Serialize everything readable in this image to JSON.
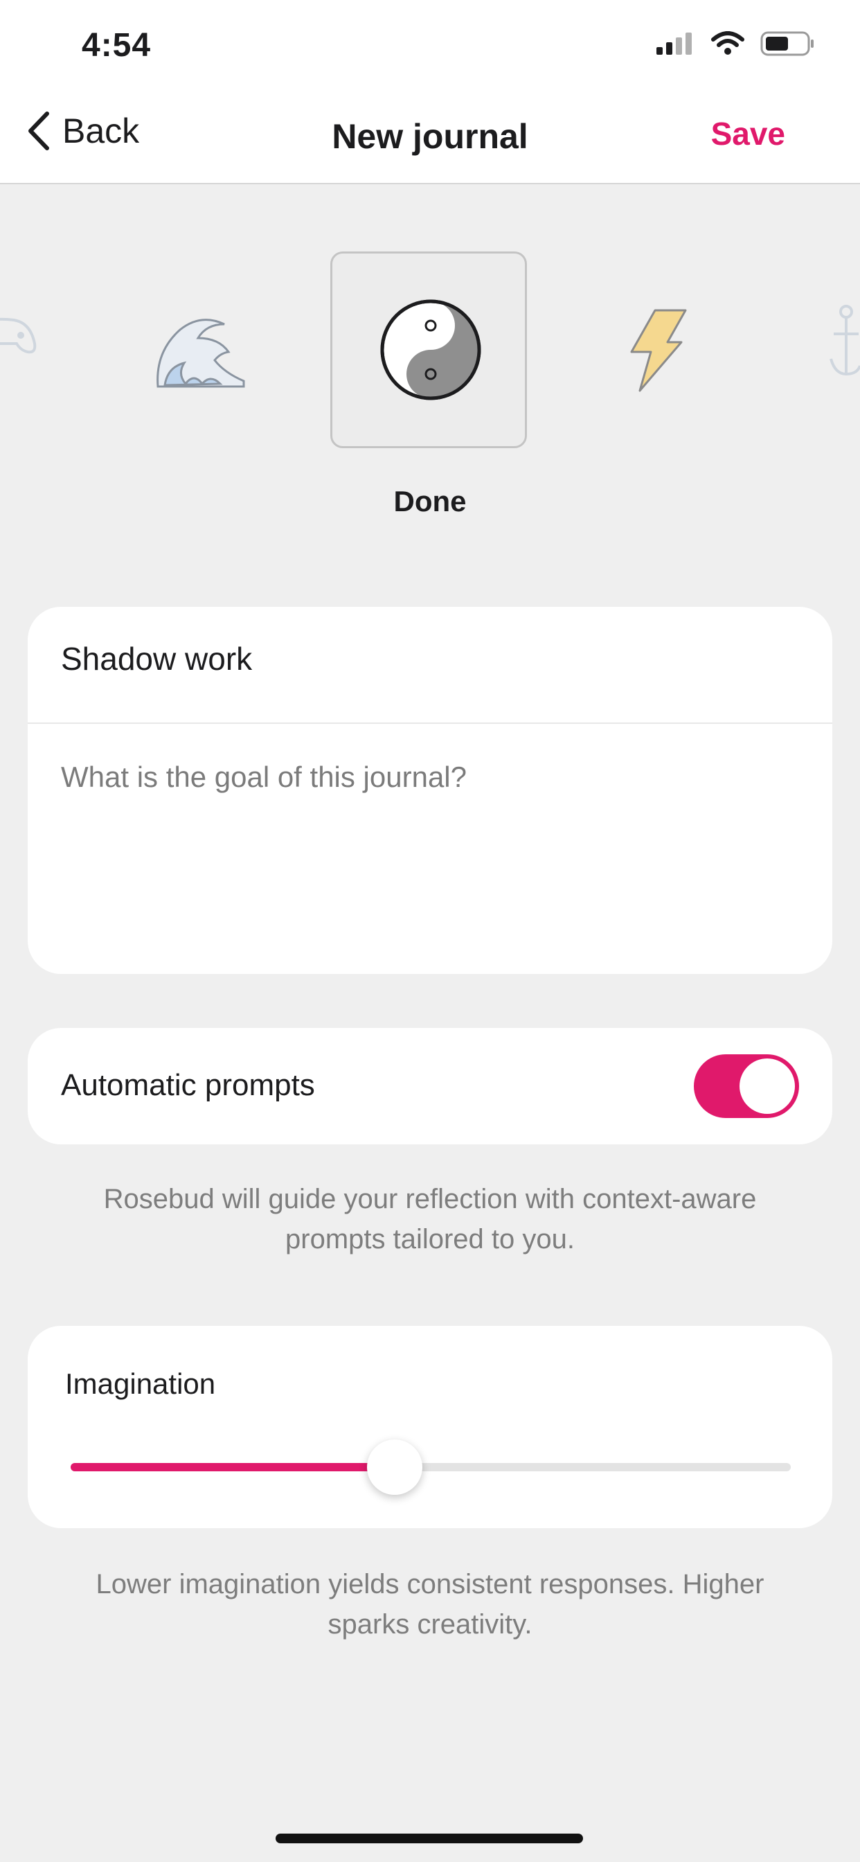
{
  "status_bar": {
    "time": "4:54"
  },
  "nav": {
    "back_label": "Back",
    "title": "New journal",
    "save_label": "Save"
  },
  "icon_picker": {
    "icons": [
      "gamepad-icon",
      "wave-icon",
      "yin-yang-icon",
      "lightning-icon",
      "anchor-icon"
    ],
    "selected": "yin-yang-icon",
    "selected_label": "Done"
  },
  "journal": {
    "name": "Shadow work",
    "goal_placeholder": "What is the goal of this journal?"
  },
  "automatic_prompts": {
    "label": "Automatic prompts",
    "enabled": true,
    "help": "Rosebud will guide your reflection with context-aware prompts tailored to you."
  },
  "imagination": {
    "label": "Imagination",
    "level": 0.45,
    "help": "Lower imagination yields consistent responses. Higher sparks creativity."
  },
  "colors": {
    "accent": "#e0196b",
    "background": "#efefef"
  }
}
